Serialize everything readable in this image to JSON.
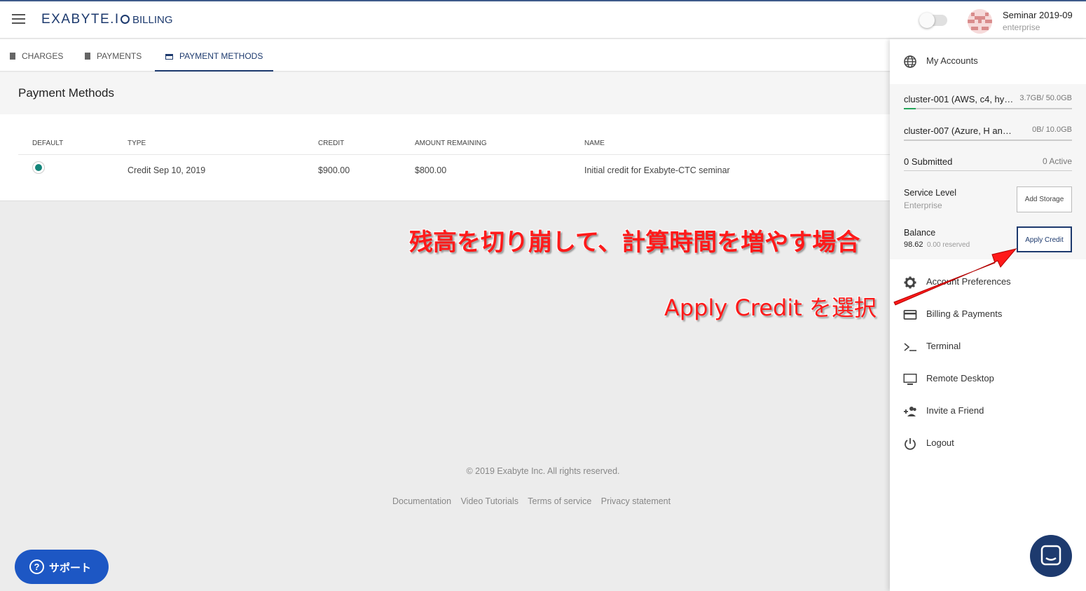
{
  "header": {
    "logo": "EXABYTE.I",
    "section": "BILLING",
    "user_name": "Seminar 2019-09",
    "user_plan": "enterprise"
  },
  "tabs": [
    {
      "label": "CHARGES"
    },
    {
      "label": "PAYMENTS"
    },
    {
      "label": "PAYMENT METHODS"
    }
  ],
  "page": {
    "title": "Payment Methods"
  },
  "table": {
    "columns": [
      "DEFAULT",
      "TYPE",
      "CREDIT",
      "AMOUNT REMAINING",
      "NAME"
    ],
    "rows": [
      {
        "type": "Credit Sep 10, 2019",
        "credit": "$900.00",
        "remaining": "$800.00",
        "name": "Initial credit for Exabyte-CTC seminar"
      }
    ]
  },
  "drawer": {
    "my_accounts": "My Accounts",
    "accounts": [
      {
        "name": "cluster-001 (AWS, c4, hyp...",
        "usage": "3.7GB/ 50.0GB",
        "fill": 0.07
      },
      {
        "name": "cluster-007 (Azure, H and NC...",
        "usage": "0B/ 10.0GB",
        "fill": 0
      }
    ],
    "submitted": "0 Submitted",
    "active": "0 Active",
    "service_level_label": "Service Level",
    "service_level_value": "Enterprise",
    "add_storage": "Add Storage",
    "balance_label": "Balance",
    "balance_value": "98.62",
    "balance_reserved": "0.00 reserved",
    "apply_credit": "Apply Credit",
    "menu": [
      {
        "label": "Account Preferences",
        "icon": "gear-icon"
      },
      {
        "label": "Billing & Payments",
        "icon": "credit-card-icon"
      },
      {
        "label": "Terminal",
        "icon": "terminal-icon"
      },
      {
        "label": "Remote Desktop",
        "icon": "monitor-icon"
      },
      {
        "label": "Invite a Friend",
        "icon": "add-people-icon"
      },
      {
        "label": "Logout",
        "icon": "power-icon"
      }
    ]
  },
  "footer": {
    "copyright": "© 2019 Exabyte Inc. All rights reserved.",
    "links": [
      "Documentation",
      "Video Tutorials",
      "Terms of service",
      "Privacy statement"
    ]
  },
  "support": {
    "label": "サポート"
  },
  "annotations": {
    "headline": "残高を切り崩して、計算時間を増やす場合",
    "instruction": "Apply Credit を選択",
    "color": "#ff1a1a"
  },
  "colors": {
    "brand": "#1d3a6e",
    "radio": "#14857a",
    "support": "#1d57c4"
  }
}
